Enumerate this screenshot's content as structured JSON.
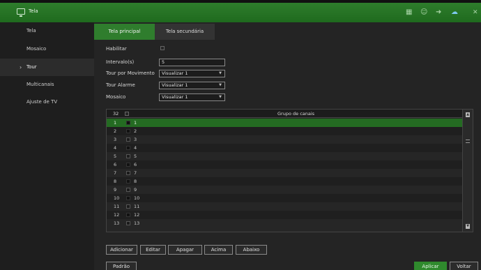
{
  "window": {
    "title": "Tela"
  },
  "toolbar_icons": [
    "grid-icon",
    "users-icon",
    "logout-icon",
    "cloud-icon",
    "close-icon"
  ],
  "sidebar": {
    "items": [
      {
        "label": "Tela",
        "active": false
      },
      {
        "label": "Mosaico",
        "active": false
      },
      {
        "label": "Tour",
        "active": true,
        "arrow": "›"
      },
      {
        "label": "Multicanais",
        "active": false
      },
      {
        "label": "Ajuste de TV",
        "active": false
      }
    ]
  },
  "tabs": [
    {
      "label": "Tela principal",
      "active": true
    },
    {
      "label": "Tela secundária",
      "active": false
    }
  ],
  "form": {
    "enable_label": "Habilitar",
    "interval_label": "Intervalo(s)",
    "interval_value": "5",
    "motion_label": "Tour por Movimento",
    "motion_value": "Visualizar 1",
    "alarm_label": "Tour Alarme",
    "alarm_value": "Visualizar 1",
    "mosaic_label": "Mosaico",
    "mosaic_value": "Visualizar 1"
  },
  "table": {
    "header_count": "32",
    "header_group": "Grupo de canais",
    "rows": [
      {
        "num": "1",
        "channel": "1"
      },
      {
        "num": "2",
        "channel": "2"
      },
      {
        "num": "3",
        "channel": "3"
      },
      {
        "num": "4",
        "channel": "4"
      },
      {
        "num": "5",
        "channel": "5"
      },
      {
        "num": "6",
        "channel": "6"
      },
      {
        "num": "7",
        "channel": "7"
      },
      {
        "num": "8",
        "channel": "8"
      },
      {
        "num": "9",
        "channel": "9"
      },
      {
        "num": "10",
        "channel": "10"
      },
      {
        "num": "11",
        "channel": "11"
      },
      {
        "num": "12",
        "channel": "12"
      },
      {
        "num": "13",
        "channel": "13"
      }
    ]
  },
  "actions": {
    "add": "Adicionar",
    "edit": "Editar",
    "delete": "Apagar",
    "up": "Acima",
    "down": "Abaixo"
  },
  "footer": {
    "default": "Padrão",
    "apply": "Aplicar",
    "back": "Voltar"
  },
  "colors": {
    "accent": "#2f7d2d",
    "selected_row": "#246b22"
  }
}
